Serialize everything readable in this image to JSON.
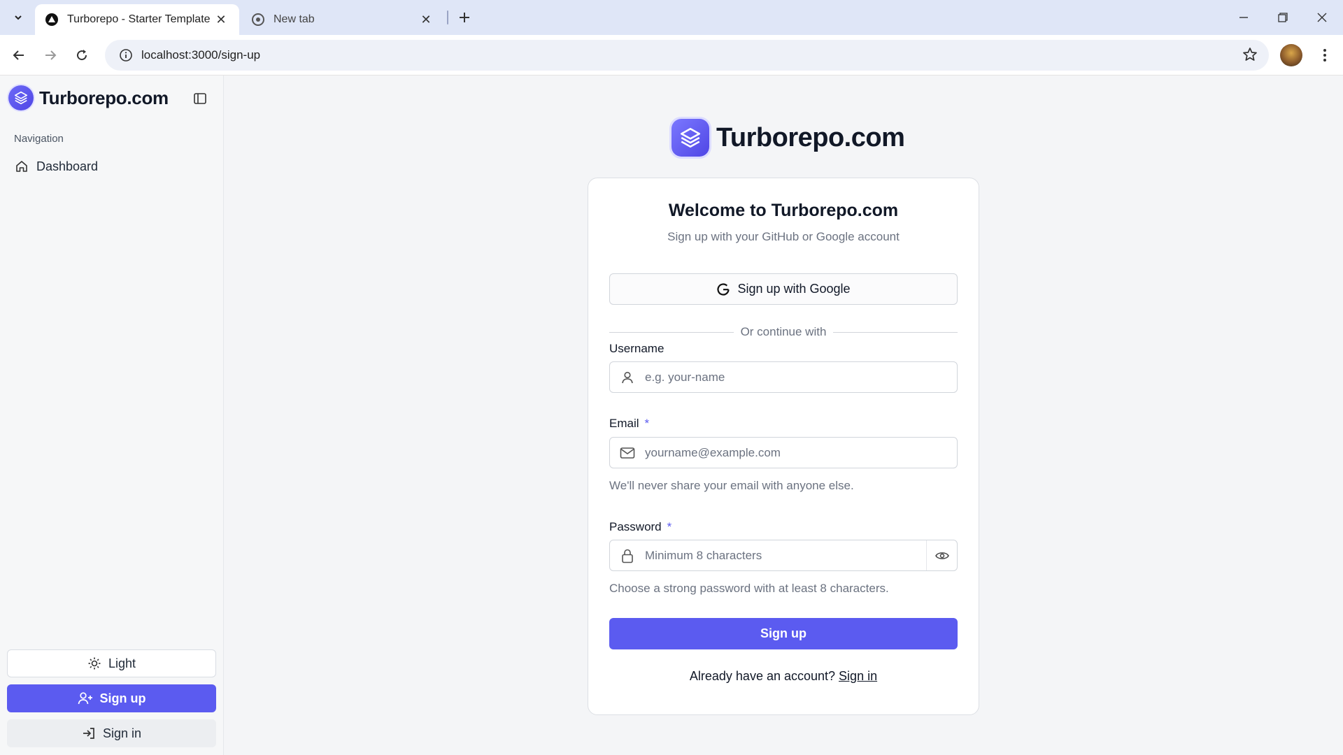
{
  "browser": {
    "tabs": [
      {
        "title": "Turborepo - Starter Template",
        "active": true
      },
      {
        "title": "New tab",
        "active": false
      }
    ],
    "url": "localhost:3000/sign-up"
  },
  "sidebar": {
    "brand": "Turborepo.com",
    "section_label": "Navigation",
    "items": [
      {
        "label": "Dashboard",
        "icon": "home-icon"
      }
    ],
    "theme_label": "Light",
    "signup_label": "Sign up",
    "signin_label": "Sign in"
  },
  "main": {
    "brand": "Turborepo.com",
    "card": {
      "title": "Welcome to Turborepo.com",
      "subtitle": "Sign up with your GitHub or Google account",
      "google_button": "Sign up with Google",
      "divider": "Or continue with",
      "username": {
        "label": "Username",
        "placeholder": "e.g. your-name"
      },
      "email": {
        "label": "Email",
        "required": "*",
        "placeholder": "yourname@example.com",
        "hint": "We'll never share your email with anyone else."
      },
      "password": {
        "label": "Password",
        "required": "*",
        "placeholder": "Minimum 8 characters",
        "hint": "Choose a strong password with at least 8 characters."
      },
      "submit": "Sign up",
      "footer_text": "Already have an account?",
      "footer_link": "Sign in"
    }
  },
  "colors": {
    "accent": "#5b5bf0",
    "sidebar_bg": "#f6f7f8",
    "main_bg": "#f4f5f7"
  }
}
